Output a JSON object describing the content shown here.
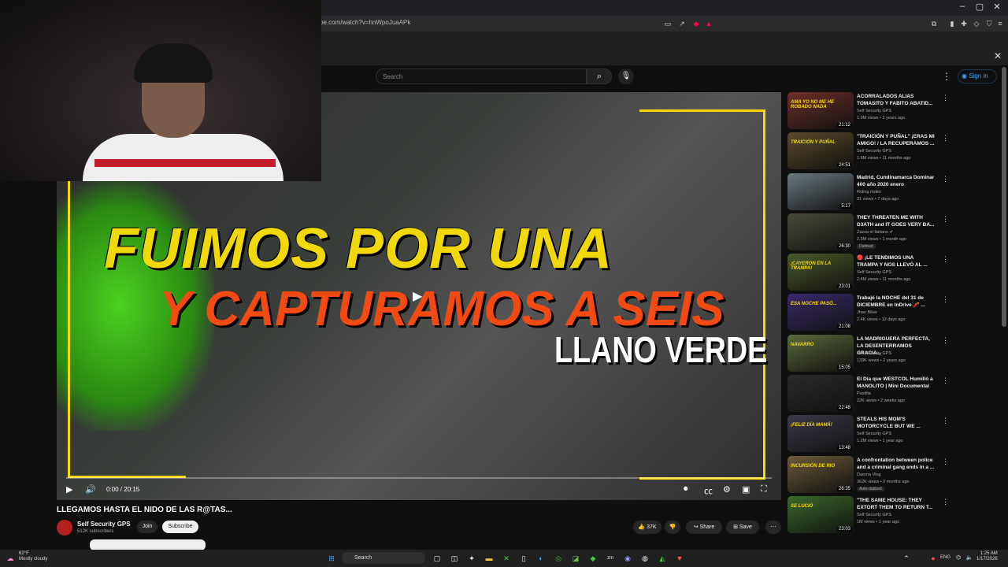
{
  "browser": {
    "url": "be.com/watch?v=hnWpoJuaAPk",
    "window_controls": [
      "–",
      "▢",
      "✕"
    ]
  },
  "youtube": {
    "search_placeholder": "Search",
    "signin_label": "Sign in"
  },
  "video": {
    "overlay_line1": "FUIMOS POR UNA",
    "overlay_line2": "Y CAPTURAMOS A SEIS",
    "overlay_line3": "LLANO VERDE",
    "time": "0:00 / 20:15",
    "title": "LLEGAMOS HASTA EL NIDO DE LAS R@TAS...",
    "channel": "Self Security GPS",
    "subscribers": "512K subscribers",
    "join_label": "Join",
    "subscribe_label": "Subscribe",
    "likes": "37K",
    "share_label": "Share",
    "save_label": "Save"
  },
  "related": [
    {
      "title": "ACORRALADOS ALIAS TOMASITO Y FABITO ABATID...",
      "channel": "Self Security GPS",
      "meta": "1.9M views • 2 years ago",
      "duration": "21:12",
      "thumb": "AMA YO NO ME HE ROBADO NADA",
      "color": "#6e2f2a"
    },
    {
      "title": "\"TRAICIÓN Y PUÑAL\" ¡ERAS MI AMIGO! / LA RECUPERAMOS ...",
      "channel": "Self Security GPS",
      "meta": "1.6M views • 11 months ago",
      "duration": "24:51",
      "thumb": "TRAICIÓN Y PUÑAL",
      "color": "#5a4a2a"
    },
    {
      "title": "Madrid, Cundinamarca Dominar 400 año 2020 enero",
      "channel": "Riding motor",
      "meta": "31 views • 7 days ago",
      "duration": "5:17",
      "thumb": "",
      "color": "#6b7a80"
    },
    {
      "title": "THEY THREATEN ME WITH D3ATH and IT GOES VERY BA...",
      "channel": "Zazza el Italiano ✔",
      "meta": "2.5M views • 1 month ago",
      "duration": "26:30",
      "badge": "Dubbed",
      "thumb": "",
      "color": "#4a4a3a"
    },
    {
      "title": "🔴 ¡LE TENDIMOS UNA TRAMPA Y NOS LLEVÓ AL ...",
      "channel": "Self Security GPS",
      "meta": "2.4M views • 11 months ago",
      "duration": "23:01",
      "thumb": "¡CAYERON EN LA TRAMPA!",
      "color": "#4a5a2a"
    },
    {
      "title": "Trabajé la NOCHE del 31 de DICIEMBRE en InDrive 🧨 ...",
      "channel": "Jhan Biker",
      "meta": "2.4K views • 12 days ago",
      "duration": "21:08",
      "thumb": "ESA NOCHE PASÓ...",
      "color": "#3a2a6a"
    },
    {
      "title": "LA MADRIGUERA PERFECTA, LA DESENTERRAMOS GRACIA...",
      "channel": "Self Security GPS",
      "meta": "133K views • 2 years ago",
      "duration": "15:05",
      "thumb": "NAVARRO",
      "color": "#5a6a3a"
    },
    {
      "title": "El Día que WESTCOL Humilló a MANOLITO | Mini Documental",
      "channel": "Pastilla",
      "meta": "22K views • 2 weeks ago",
      "duration": "22:48",
      "thumb": "",
      "color": "#2a2a2a"
    },
    {
      "title": "STEALS HIS MOM'S MOTORCYCLE BUT WE ...",
      "channel": "Self Security GPS",
      "meta": "1.2M views • 1 year ago",
      "duration": "13:48",
      "thumb": "¡FELIZ DÍA MAMÁ!",
      "color": "#3a3a4a"
    },
    {
      "title": "A confrontation between police and a criminal gang ends in a ...",
      "channel": "Daorna Vlog",
      "meta": "362K views • 2 months ago",
      "duration": "26:35",
      "badge": "Auto-dubbed",
      "thumb": "INCURSIÓN DE RIO",
      "color": "#6a5a3a"
    },
    {
      "title": "\"THE SAME HOUSE: THEY EXTORT THEM TO RETURN T...",
      "channel": "Self Security GPS",
      "meta": "1M views • 1 year ago",
      "duration": "23:03",
      "thumb": "SE LUCIÓ",
      "color": "#3a6a2a"
    }
  ],
  "taskbar": {
    "temp": "62°F",
    "weather": "Mostly cloudy",
    "search_label": "Search",
    "lang": "ENG",
    "time": "1:25 AM",
    "date": "1/17/2026"
  },
  "colors": {
    "accent": "#f5d90a",
    "yt_bg": "#0f0f0f",
    "link": "#3ea6ff"
  }
}
